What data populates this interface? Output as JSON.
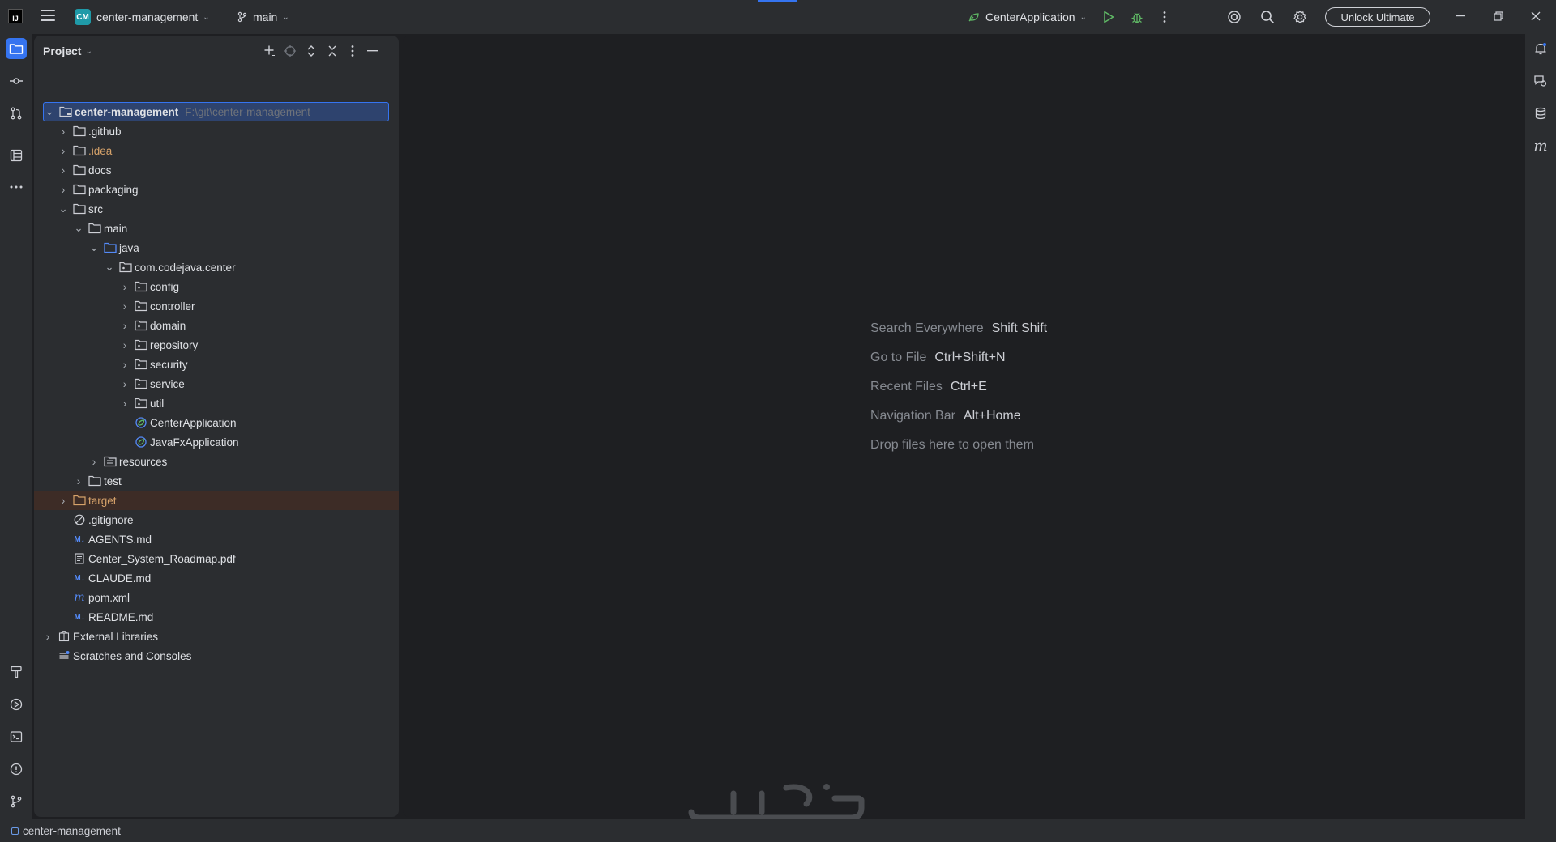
{
  "titlebar": {
    "project_badge": "CM",
    "project_name": "center-management",
    "branch": "main",
    "run_config": "CenterApplication",
    "unlock_label": "Unlock Ultimate"
  },
  "project_panel": {
    "title": "Project",
    "root": {
      "label": "center-management",
      "path": "F:\\git\\center-management"
    },
    "items": [
      {
        "label": ".github"
      },
      {
        "label": ".idea"
      },
      {
        "label": "docs"
      },
      {
        "label": "packaging"
      },
      {
        "label": "src"
      },
      {
        "label": "main"
      },
      {
        "label": "java"
      },
      {
        "label": "com.codejava.center"
      },
      {
        "label": "config"
      },
      {
        "label": "controller"
      },
      {
        "label": "domain"
      },
      {
        "label": "repository"
      },
      {
        "label": "security"
      },
      {
        "label": "service"
      },
      {
        "label": "util"
      },
      {
        "label": "CenterApplication"
      },
      {
        "label": "JavaFxApplication"
      },
      {
        "label": "resources"
      },
      {
        "label": "test"
      },
      {
        "label": "target"
      },
      {
        "label": ".gitignore"
      },
      {
        "label": "AGENTS.md"
      },
      {
        "label": "Center_System_Roadmap.pdf"
      },
      {
        "label": "CLAUDE.md"
      },
      {
        "label": "pom.xml"
      },
      {
        "label": "README.md"
      },
      {
        "label": "External Libraries"
      },
      {
        "label": "Scratches and Consoles"
      }
    ]
  },
  "editor": {
    "hints": [
      {
        "label": "Search Everywhere",
        "key": "Shift Shift"
      },
      {
        "label": "Go to File",
        "key": "Ctrl+Shift+N"
      },
      {
        "label": "Recent Files",
        "key": "Ctrl+E"
      },
      {
        "label": "Navigation Bar",
        "key": "Alt+Home"
      },
      {
        "label": "Drop files here to open them",
        "key": ""
      }
    ]
  },
  "statusbar": {
    "project": "center-management"
  },
  "colors": {
    "accent": "#3574f0",
    "panel": "#2b2d30",
    "editor": "#1e1f22",
    "excluded_folder": "#d6a26a"
  }
}
